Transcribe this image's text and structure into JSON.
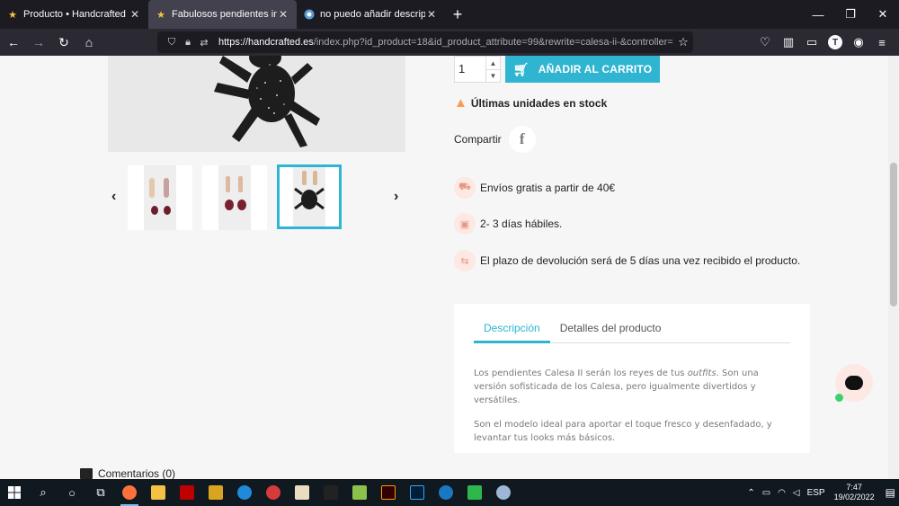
{
  "browser": {
    "tabs": [
      {
        "title": "Producto • Handcrafted",
        "icon": "star-icon",
        "active": false
      },
      {
        "title": "Fabulosos pendientes inspiraci",
        "icon": "star-icon",
        "active": true
      },
      {
        "title": "no puedo añadir descripciones",
        "icon": "globe-icon",
        "active": false
      }
    ],
    "url_host": "https://handcrafted.es",
    "url_path": "/index.php?id_product=18&id_product_attribute=99&rewrite=calesa-ii-&controller=produ",
    "profile_initial": "T"
  },
  "product": {
    "quantity": "1",
    "add_to_cart": "AÑADIR AL CARRITO",
    "stock_notice": "Últimas unidades en stock",
    "share_label": "Compartir",
    "facebook_glyph": "f",
    "reassurance": [
      {
        "text": "Envíos gratis a partir de 40€",
        "icon": "truck-icon"
      },
      {
        "text": "2- 3 días hábiles.",
        "icon": "package-icon"
      },
      {
        "text": "El plazo de devolución será de 5 días una vez recibido el producto.",
        "icon": "return-icon"
      }
    ],
    "tabs": {
      "description": "Descripción",
      "details": "Detalles del producto"
    },
    "description_p1_a": "Los pendientes Calesa II serán los reyes de tus ",
    "description_p1_em": "outfits",
    "description_p1_b": ". Son una versión sofisticada de los Calesa, pero igualmente divertidos y versátiles.",
    "description_p2": "Son el modelo ideal para aportar el toque fresco y desenfadado, y levantar tus looks más básicos.",
    "comments": "Comentarios (0)"
  },
  "gallery": {
    "thumbnails": 3,
    "selected_index": 2
  },
  "taskbar": {
    "language": "ESP",
    "time": "7:47",
    "date": "19/02/2022"
  },
  "colors": {
    "accent": "#2fb5d2",
    "warning": "#ff9a52",
    "reassure_icon": "#e7967f"
  }
}
